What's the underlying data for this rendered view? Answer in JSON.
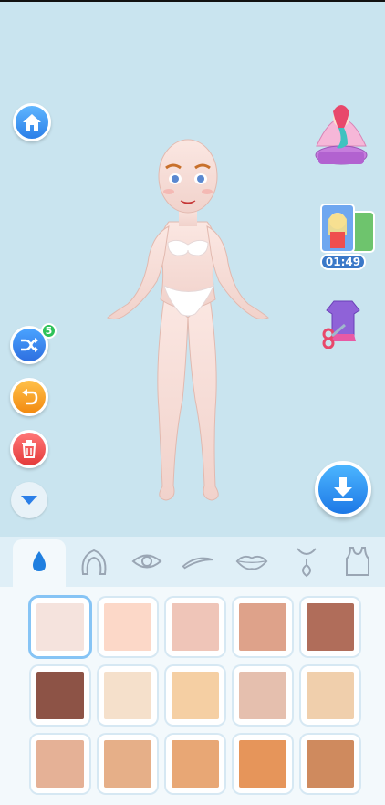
{
  "side_controls": {
    "shuffle_badge": "5",
    "timer": "01:49"
  },
  "icons": {
    "home": "home-icon",
    "shuffle": "shuffle-icon",
    "undo": "undo-icon",
    "trash": "trash-icon",
    "collapse": "chevron-down-icon",
    "download": "download-icon",
    "mermaid": "mermaid-shell-icon",
    "cards": "character-cards-icon",
    "tailor": "dress-scissors-icon"
  },
  "tabs": [
    {
      "name": "skin-tab",
      "icon": "drop-icon"
    },
    {
      "name": "hair-tab",
      "icon": "hair-icon"
    },
    {
      "name": "eyes-tab",
      "icon": "eye-icon"
    },
    {
      "name": "brows-tab",
      "icon": "brow-icon"
    },
    {
      "name": "lips-tab",
      "icon": "lips-icon"
    },
    {
      "name": "necklace-tab",
      "icon": "necklace-icon"
    },
    {
      "name": "top-tab",
      "icon": "tank-top-icon"
    }
  ],
  "skin_tones": [
    "#f5e3dd",
    "#fcd8c8",
    "#efc5b8",
    "#dea28a",
    "#b06d5a",
    "#8d5346",
    "#f5e0cb",
    "#f5cfa3",
    "#e5bfae",
    "#f0cfac",
    "#e5b196",
    "#e6af88",
    "#e8a775",
    "#e6955a",
    "#cf8a5e"
  ],
  "selected_tone": 0,
  "colors": {
    "background": "#c9e4ef",
    "panel": "#dfeff7",
    "accent": "#2b7fe8"
  }
}
